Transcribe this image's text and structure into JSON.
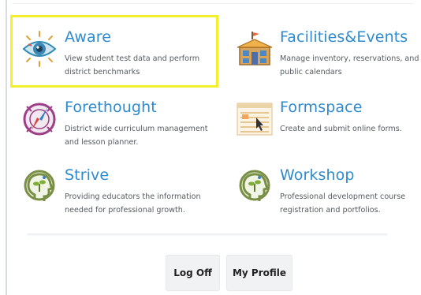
{
  "apps": [
    {
      "title": "Aware",
      "description": "View student test data and perform district benchmarks",
      "icon": "eye-icon"
    },
    {
      "title": "Facilities&Events",
      "description": "Manage inventory, reservations, and public calendars",
      "icon": "building-icon"
    },
    {
      "title": "Forethought",
      "description": "District wide curriculum management and lesson planner.",
      "icon": "compass-icon"
    },
    {
      "title": "Formspace",
      "description": "Create and submit online forms.",
      "icon": "forms-icon"
    },
    {
      "title": "Strive",
      "description": "Providing educators the information needed for professional growth.",
      "icon": "growth-head-icon"
    },
    {
      "title": "Workshop",
      "description": "Professional development course registration and portfolios.",
      "icon": "growth-head-icon"
    }
  ],
  "buttons": {
    "log_off": "Log Off",
    "my_profile": "My Profile"
  },
  "colors": {
    "title": "#2e8bcf",
    "highlight": "#f2ef2c",
    "strive": "#7a8f46"
  }
}
